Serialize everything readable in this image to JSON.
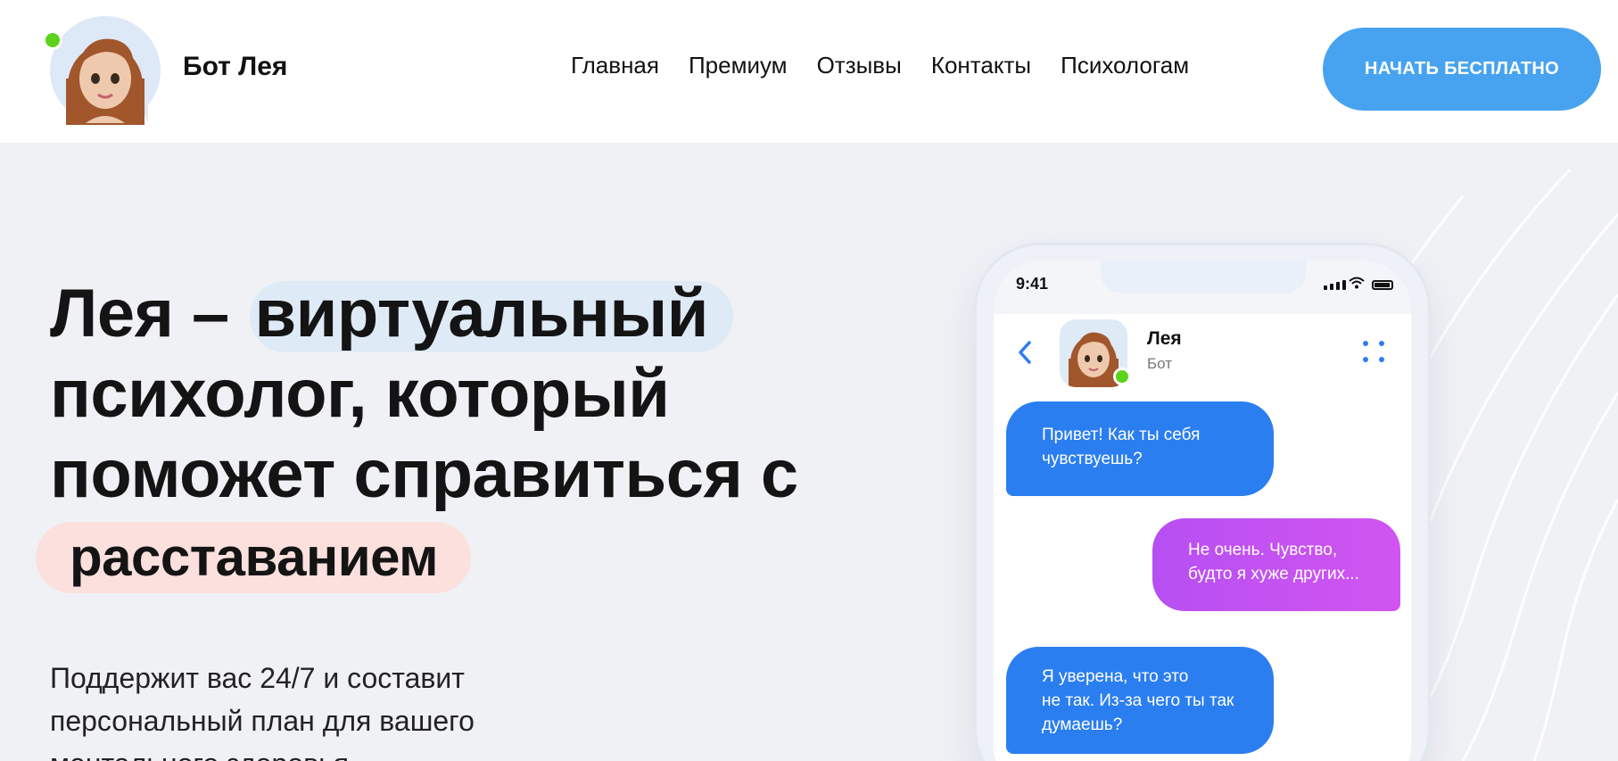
{
  "brand": {
    "name": "Бот Лея"
  },
  "nav": {
    "items": [
      "Главная",
      "Премиум",
      "Отзывы",
      "Контакты",
      "Психологам"
    ]
  },
  "cta": {
    "label": "НАЧАТЬ БЕСПЛАТНО"
  },
  "hero": {
    "line1_prefix": "Лея –",
    "line1_highlight": "виртуальный",
    "line2": "психолог, который",
    "line3": "поможет справиться с",
    "highlight_word": "расставанием",
    "subtitle_lines": [
      "Поддержит вас 24/7 и составит",
      "персональный план для вашего",
      "ментального здоровья"
    ]
  },
  "phone": {
    "time": "9:41",
    "contact_name": "Лея",
    "contact_sub": "Бот",
    "messages": [
      {
        "from": "bot",
        "lines": [
          "Привет! Как ты себя",
          "чувствуешь?"
        ]
      },
      {
        "from": "user",
        "lines": [
          "Не очень. Чувство,",
          "будто я хуже других..."
        ]
      },
      {
        "from": "bot",
        "lines": [
          "Я уверена, что это",
          "не так. Из-за чего ты так",
          "думаешь?"
        ]
      }
    ]
  },
  "colors": {
    "accent": "#47a3ef",
    "bot_bubble": "#2b7ef0",
    "user_bubble": "#c352f1",
    "online": "#5dd21d",
    "highlight_blue": "#dfeaf7",
    "highlight_pink": "#fbe0dd"
  }
}
